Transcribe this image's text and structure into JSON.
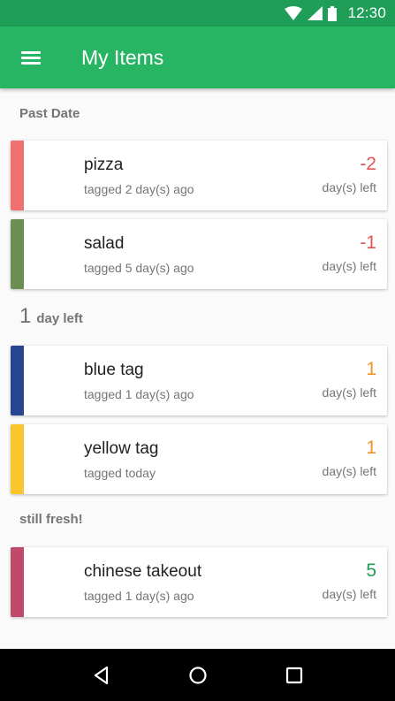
{
  "status_bar": {
    "time": "12:30",
    "icons": [
      "wifi-icon",
      "signal-icon",
      "battery-icon"
    ]
  },
  "app_bar": {
    "title": "My Items",
    "menu_icon": "hamburger-menu-icon"
  },
  "sections": [
    {
      "header": "Past Date",
      "items": [
        {
          "name": "pizza",
          "tagged": "tagged 2 day(s) ago",
          "days": "-2",
          "days_label": "day(s) left",
          "tag_color": "#f07070",
          "days_color": "#e05555"
        },
        {
          "name": "salad",
          "tagged": "tagged 5 day(s) ago",
          "days": "-1",
          "days_label": "day(s) left",
          "tag_color": "#6b8f53",
          "days_color": "#e05555"
        }
      ]
    },
    {
      "header_number": "1",
      "header": "day left",
      "items": [
        {
          "name": "blue tag",
          "tagged": "tagged 1 day(s) ago",
          "days": "1",
          "days_label": "day(s) left",
          "tag_color": "#28468f",
          "days_color": "#f0922a"
        },
        {
          "name": "yellow tag",
          "tagged": "tagged today",
          "days": "1",
          "days_label": "day(s) left",
          "tag_color": "#fbc52d",
          "days_color": "#f0922a"
        }
      ]
    },
    {
      "header": "still fresh!",
      "items": [
        {
          "name": "chinese takeout",
          "tagged": "tagged 1 day(s) ago",
          "days": "5",
          "days_label": "day(s) left",
          "tag_color": "#c04a6a",
          "days_color": "#1e9e56"
        }
      ]
    }
  ],
  "nav_bar": {
    "icons": [
      "back-icon",
      "home-icon",
      "recents-icon"
    ]
  },
  "colors": {
    "status_bar": "#1e9e56",
    "app_bar": "#27b463"
  }
}
